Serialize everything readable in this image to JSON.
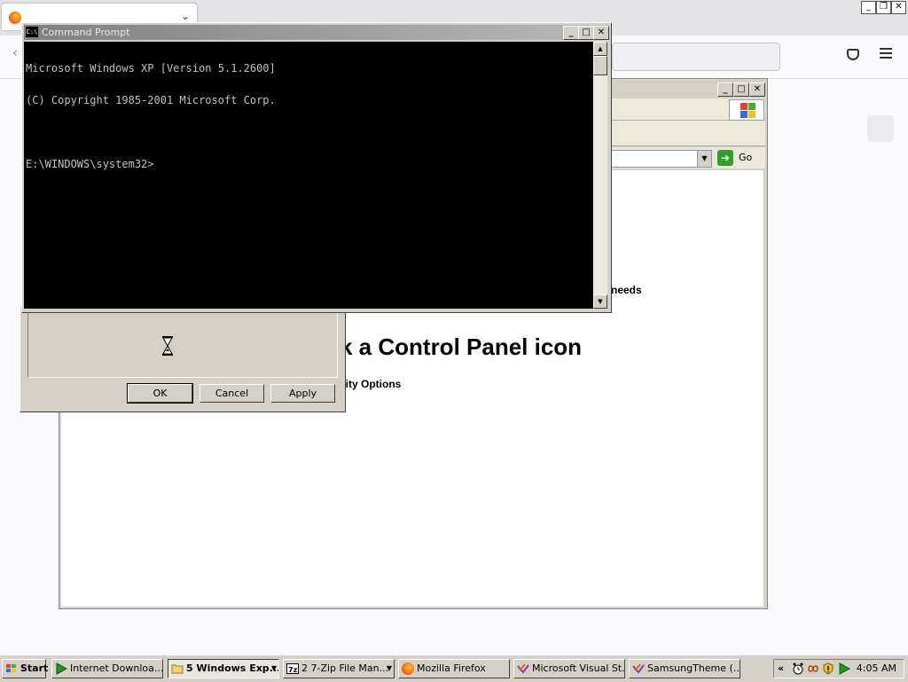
{
  "firefox": {
    "window_controls": [
      "_",
      "❐",
      "✕"
    ]
  },
  "control_panel": {
    "window_controls": [
      "_",
      "□",
      "✕"
    ],
    "go_label": "Go",
    "pick_heading": "k a Control Panel icon",
    "needs_text": "needs",
    "accessibility_text": "ility Options"
  },
  "dialog": {
    "buttons": {
      "ok": "OK",
      "cancel": "Cancel",
      "apply": "Apply"
    }
  },
  "cmd": {
    "title": "Command Prompt",
    "icon_text": "C:\\",
    "window_controls": [
      "_",
      "□",
      "✕"
    ],
    "lines": [
      "Microsoft Windows XP [Version 5.1.2600]",
      "(C) Copyright 1985-2001 Microsoft Corp.",
      "",
      "E:\\WINDOWS\\system32>"
    ]
  },
  "taskbar": {
    "start_label": "Start",
    "buttons": [
      {
        "label": "Internet Downloa...",
        "icon": "download-arrow-icon"
      },
      {
        "label": "5 Windows Exp...",
        "icon": "folder-icon",
        "active": true
      },
      {
        "label": "2  7-Zip File Man...",
        "icon": "7zip-icon"
      },
      {
        "label": "Mozilla Firefox",
        "icon": "firefox-icon"
      },
      {
        "label": "Microsoft Visual St...",
        "icon": "visual-studio-icon"
      },
      {
        "label": "SamsungTheme (...",
        "icon": "visual-studio-icon"
      }
    ],
    "tray_chevron": "«",
    "clock": "4:05 AM"
  },
  "colors": {
    "xp_face": "#d4d0c8",
    "console_bg": "#000000",
    "console_fg": "#c0c0c0",
    "go_green": "#2e9e2e"
  }
}
